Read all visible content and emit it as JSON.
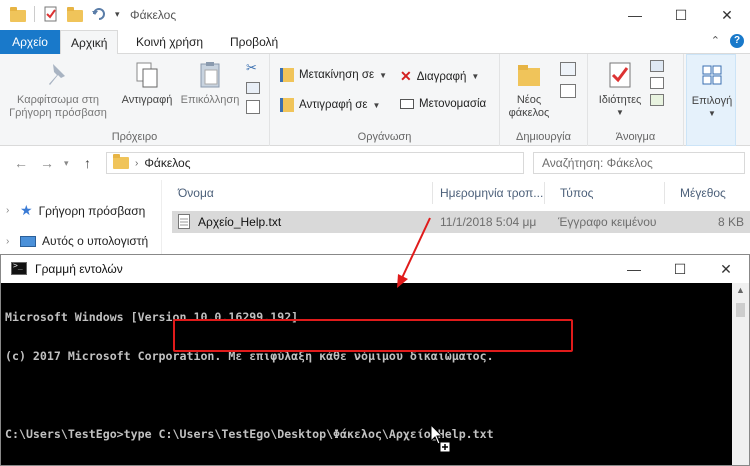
{
  "explorer": {
    "title": "Φάκελος",
    "tabs": {
      "file": "Αρχείο",
      "home": "Αρχική",
      "share": "Κοινή χρήση",
      "view": "Προβολή"
    },
    "ribbon": {
      "pin": "Καρφίτσωμα στη Γρήγορη πρόσβαση",
      "copy": "Αντιγραφή",
      "paste": "Επικόλληση",
      "clipboard_group": "Πρόχειρο",
      "move_to": "Μετακίνηση σε",
      "copy_to": "Αντιγραφή σε",
      "delete": "Διαγραφή",
      "rename": "Μετονομασία",
      "organize_group": "Οργάνωση",
      "new_folder": "Νέος φάκελος",
      "new_group": "Δημιουργία",
      "properties": "Ιδιότητες",
      "open_group": "Άνοιγμα",
      "select": "Επιλογή"
    },
    "address": {
      "path": "Φάκελος",
      "search_placeholder": "Αναζήτηση: Φάκελος"
    },
    "nav": {
      "quick_access": "Γρήγορη πρόσβαση",
      "this_pc": "Αυτός ο υπολογιστή"
    },
    "columns": {
      "name": "Όνομα",
      "date": "Ημερομηνία τροπ...",
      "type": "Τύπος",
      "size": "Μέγεθος"
    },
    "file": {
      "name": "Αρχείο_Help.txt",
      "date": "11/1/2018 5:04 μμ",
      "type": "Έγγραφο κειμένου",
      "size": "8 KB"
    }
  },
  "cmd": {
    "title": "Γραμμή εντολών",
    "lines": [
      "Microsoft Windows [Version 10.0.16299.192]",
      "(c) 2017 Microsoft Corporation. Με επιφύλαξη κάθε νόμιμου δικαιώματος.",
      "",
      "C:\\Users\\TestEgo>type C:\\Users\\TestEgo\\Desktop\\Φάκελος\\Αρχείο_Help.txt"
    ]
  },
  "colors": {
    "accent": "#1979ca",
    "highlight": "#e01b1b"
  }
}
